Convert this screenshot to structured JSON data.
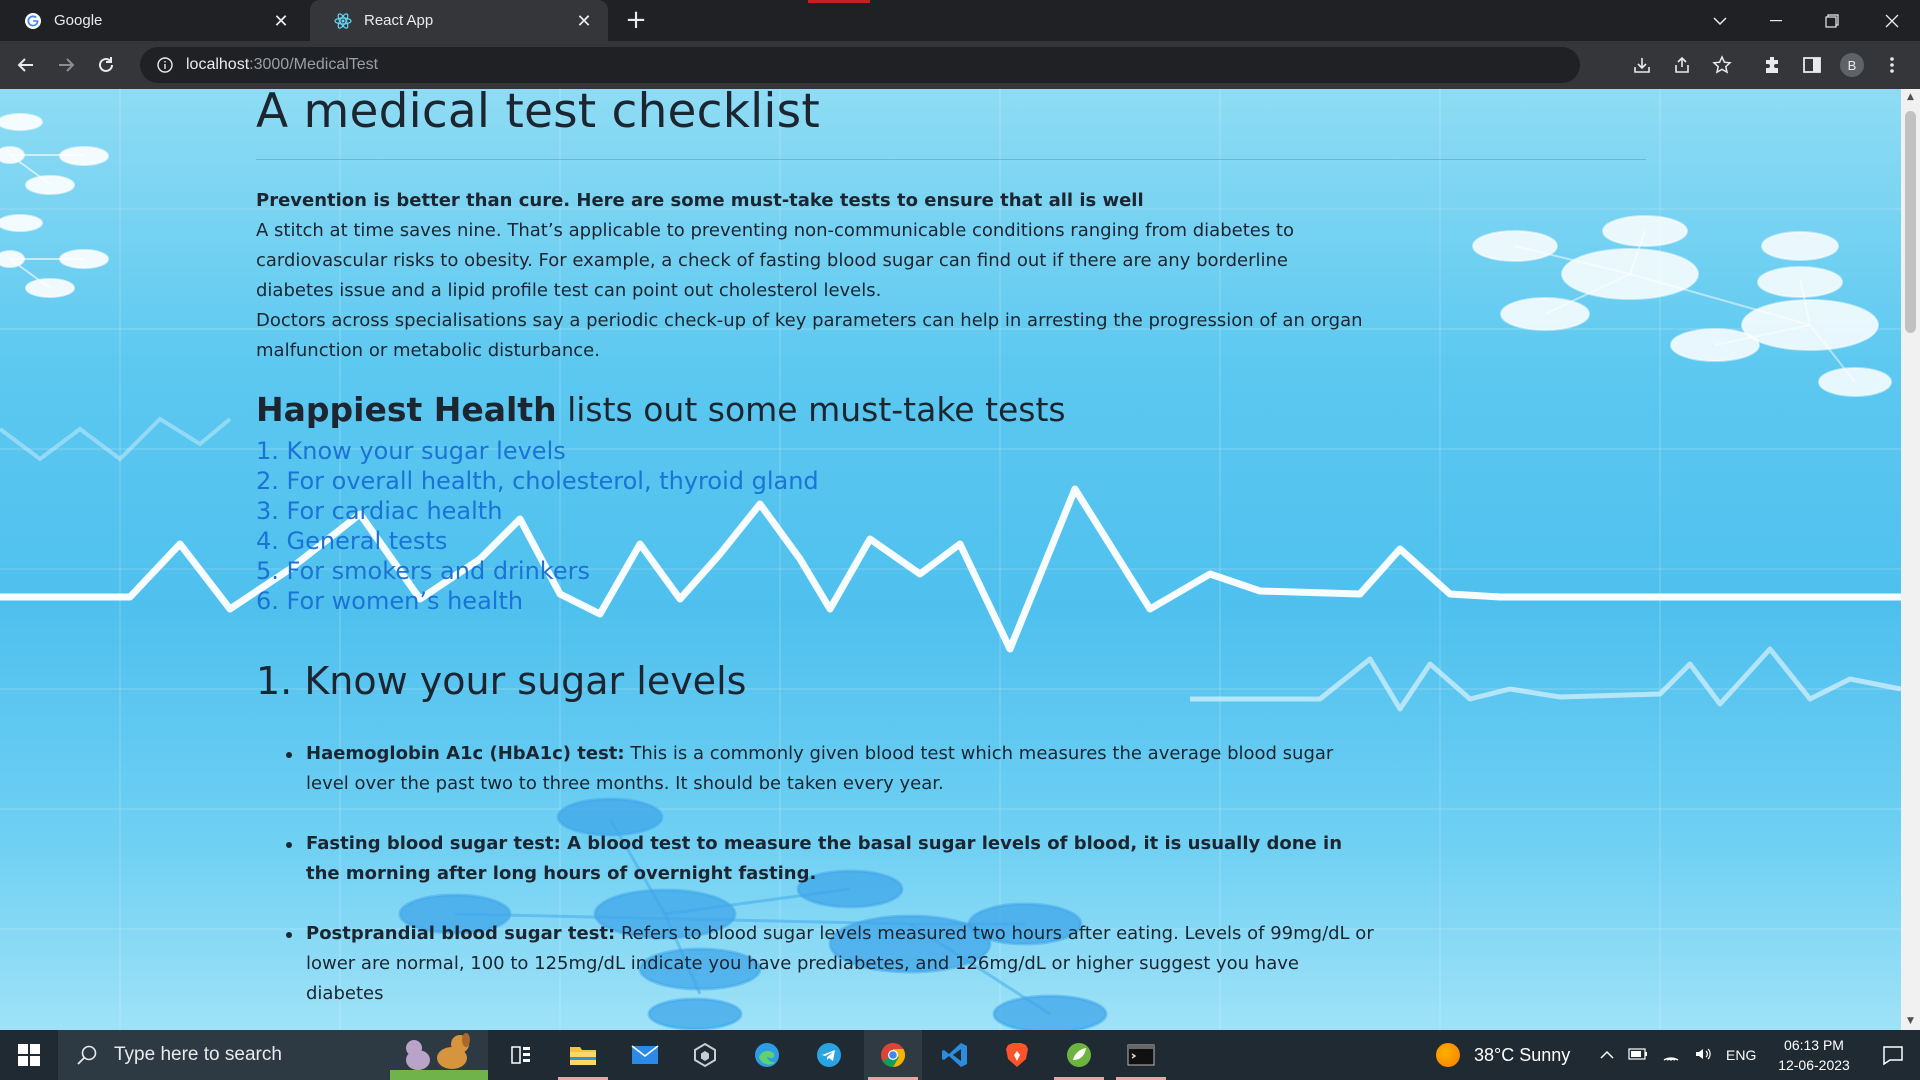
{
  "browser": {
    "tabs": [
      {
        "title": "Google",
        "icon": "google-icon",
        "active": false
      },
      {
        "title": "React App",
        "icon": "react-icon",
        "active": true
      }
    ],
    "url_host": "localhost",
    "url_path": ":3000/MedicalTest"
  },
  "page": {
    "title": "A medical test checklist",
    "intro_heading": "Prevention is better than cure. Here are some must-take tests to ensure that all is well",
    "intro_p1": "A stitch at time saves nine. That’s applicable to preventing non-communicable conditions ranging from diabetes to cardiovascular risks to obesity. For example, a check of fasting blood sugar can find out if there are any borderline diabetes issue and a lipid profile test can point out cholesterol levels.",
    "intro_p2": "Doctors across specialisations say a periodic check-up of key parameters can help in arresting the progression of an organ malfunction or metabolic disturbance.",
    "lists_heading_bold": "Happiest Health",
    "lists_heading_rest": " lists out some must-take tests",
    "toc": [
      "1. Know your sugar levels",
      "2. For overall health, cholesterol, thyroid gland",
      "3. For cardiac health",
      "4. General tests",
      "5. For smokers and drinkers",
      "6. For women’s health"
    ],
    "section1_title": "1. Know your sugar levels",
    "tests": [
      {
        "name": "Haemoglobin A1c (HbA1c) test:",
        "desc": " This is a commonly given blood test which measures the average blood sugar level over the past two to three months. It should be taken every year."
      },
      {
        "name": "Fasting blood sugar test: A blood test to measure the basal sugar levels of blood, it is usually done in the morning after long hours of overnight fasting.",
        "desc": ""
      },
      {
        "name": "Postprandial blood sugar test:",
        "desc": " Refers to blood sugar levels measured two hours after eating. Levels of 99mg/dL or lower are normal, 100 to 125mg/dL indicate you have prediabetes, and 126mg/dL or higher suggest you have diabetes"
      }
    ]
  },
  "taskbar": {
    "search_placeholder": "Type here to search",
    "weather": "38°C  Sunny",
    "language": "ENG",
    "time": "06:13 PM",
    "date": "12-06-2023"
  },
  "colors": {
    "link": "#1a73d6",
    "background_top": "#8fdcf4",
    "background_mid": "#4fc0ee"
  }
}
